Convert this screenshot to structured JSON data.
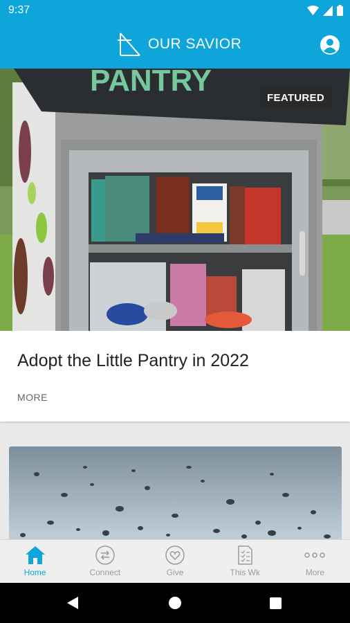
{
  "status_bar": {
    "time": "9:37"
  },
  "header": {
    "title": "OUR SAVIOR"
  },
  "featured_card": {
    "badge": "FEATURED",
    "title": "Adopt the Little Pantry  in 2022",
    "more_label": "MORE",
    "sign_text": "PANTRY"
  },
  "tabs": [
    {
      "label": "Home",
      "icon": "home-icon",
      "active": true
    },
    {
      "label": "Connect",
      "icon": "connect-icon",
      "active": false
    },
    {
      "label": "Give",
      "icon": "give-icon",
      "active": false
    },
    {
      "label": "This Wk",
      "icon": "this-week-icon",
      "active": false
    },
    {
      "label": "More",
      "icon": "more-icon",
      "active": false
    }
  ],
  "colors": {
    "accent": "#0ea5db",
    "tab_inactive": "#9a9a9a"
  }
}
